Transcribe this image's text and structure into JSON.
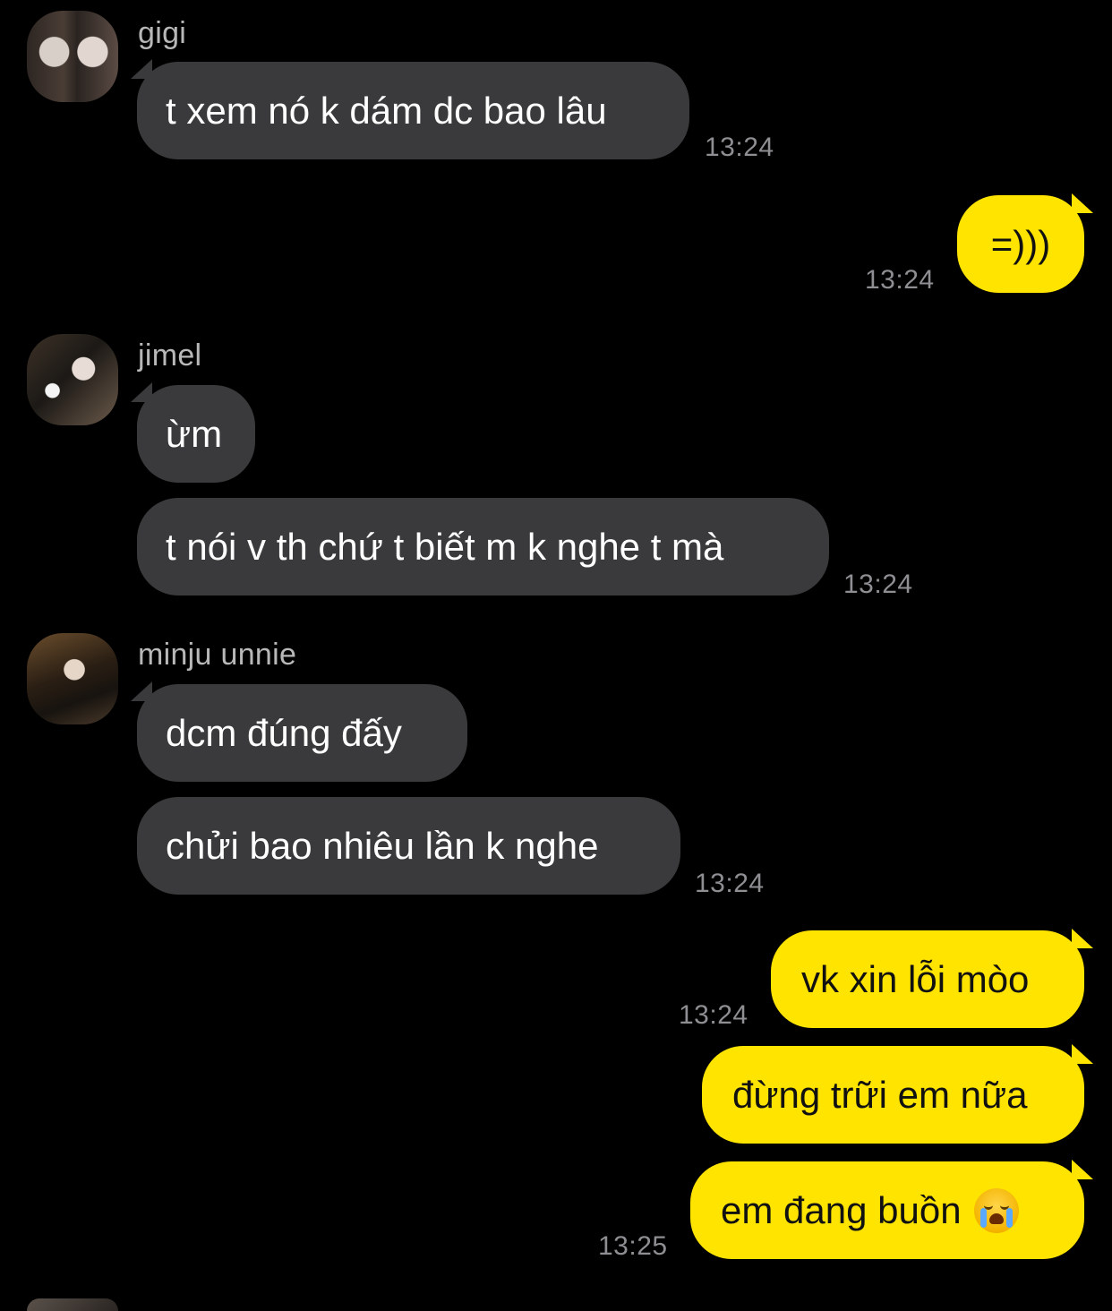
{
  "messages": {
    "m1": {
      "sender": "gigi",
      "text": "t xem nó k dám dc bao lâu",
      "time": "13:24"
    },
    "m2": {
      "text": "=)))",
      "time": "13:24"
    },
    "m3": {
      "sender": "jimel",
      "text": "ừm"
    },
    "m4": {
      "text": "t nói v th chứ t biết m k nghe t mà",
      "time": "13:24"
    },
    "m5": {
      "sender": "minju unnie",
      "text": "dcm đúng đấy"
    },
    "m6": {
      "text": "chửi bao nhiêu lần k nghe",
      "time": "13:24"
    },
    "m7": {
      "text": "vk xin lỗi mòo",
      "time": "13:24"
    },
    "m8": {
      "text": "đừng trữi em nữa"
    },
    "m9": {
      "text": "em đang buồn",
      "emoji": "loudly-crying-face-icon",
      "time": "13:25"
    }
  },
  "colors": {
    "background": "#000000",
    "incoming_bubble": "#3a3a3c",
    "outgoing_bubble": "#ffe400",
    "timestamp": "#8e8e93",
    "sender_name": "#b8b8b8"
  }
}
